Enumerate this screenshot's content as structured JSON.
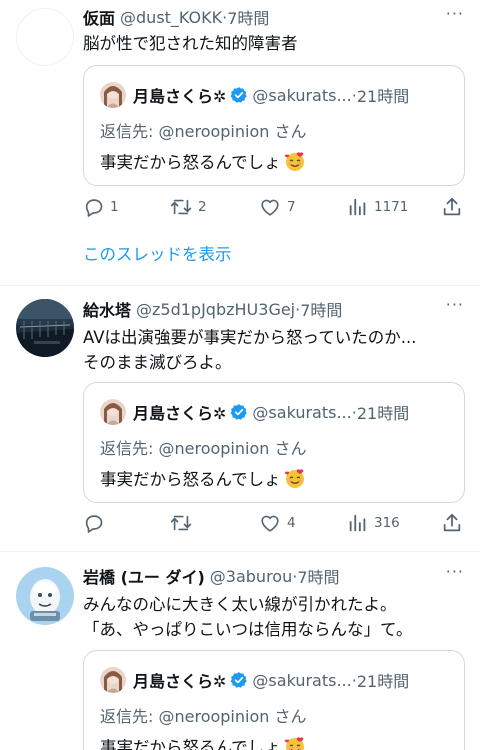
{
  "tweets": [
    {
      "name": "仮面",
      "handle": "@dust_KOKK",
      "dot": "·",
      "time": "7時間",
      "more": "···",
      "text_lines": [
        "脳が性で犯された知的障害者"
      ],
      "quote": {
        "name": "月島さくら✲",
        "handle": "@sakurats...",
        "dot": "·",
        "time": "21時間",
        "reply_prefix": "返信先: ",
        "reply_to": "@neroopinion",
        "reply_suffix": "さん",
        "text": "事実だから怒るんでしょ"
      },
      "actions": {
        "reply": "1",
        "retweet": "2",
        "like": "7",
        "views": "1171"
      },
      "show_thread": "このスレッドを表示"
    },
    {
      "name": "給水塔",
      "handle": "@z5d1pJqbzHU3Gej",
      "dot": "·",
      "time": "7時間",
      "more": "···",
      "text_lines": [
        "AVは出演強要が事実だから怒っていたのか...",
        "そのまま滅びろよ。"
      ],
      "quote": {
        "name": "月島さくら✲",
        "handle": "@sakurats...",
        "dot": "·",
        "time": "21時間",
        "reply_prefix": "返信先: ",
        "reply_to": "@neroopinion",
        "reply_suffix": "さん",
        "text": "事実だから怒るんでしょ"
      },
      "actions": {
        "reply": "",
        "retweet": "",
        "like": "4",
        "views": "316"
      }
    },
    {
      "name": "岩橋 (ユー ダイ)",
      "handle": "@3aburou",
      "dot": "·",
      "time": "7時間",
      "more": "···",
      "text_lines": [
        "みんなの心に大きく太い線が引かれたよ。",
        "「あ、やっぱりこいつは信用ならんな」て。"
      ],
      "quote": {
        "name": "月島さくら✲",
        "handle": "@sakurats...",
        "dot": "·",
        "time": "21時間",
        "reply_prefix": "返信先: ",
        "reply_to": "@neroopinion",
        "reply_suffix": "さん",
        "text": "事実だから怒るんでしょ"
      }
    }
  ],
  "colors": {
    "accent": "#1d9bf0",
    "muted": "#536471",
    "border": "#cfd9de",
    "divider": "#eff3f4"
  },
  "icons": [
    "reply-icon",
    "retweet-icon",
    "like-icon",
    "views-icon",
    "share-icon",
    "verified-badge-icon",
    "smiling-hearts-emoji-icon"
  ]
}
